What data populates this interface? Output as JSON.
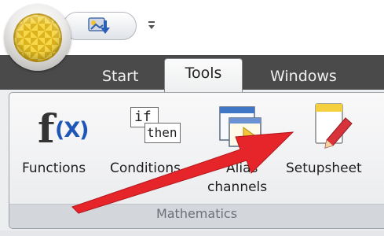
{
  "tabs": {
    "start": "Start",
    "tools": "Tools",
    "windows": "Windows"
  },
  "qat": {
    "dropdown_glyph": "▾"
  },
  "ribbon": {
    "group_label": "Mathematics",
    "buttons": {
      "functions": {
        "label": "Functions"
      },
      "conditions": {
        "label": "Conditions",
        "icon_if": "if",
        "icon_then": "then"
      },
      "alias": {
        "label_line1": "Alias",
        "label_line2": "channels"
      },
      "setupsheet": {
        "label": "Setupsheet"
      }
    },
    "functions_icon": {
      "f": "f",
      "x": "(X)"
    }
  },
  "colors": {
    "accent_red": "#e5252a",
    "ribbon_dark": "#4a4a4a",
    "orb_gold": "#eac53a"
  }
}
